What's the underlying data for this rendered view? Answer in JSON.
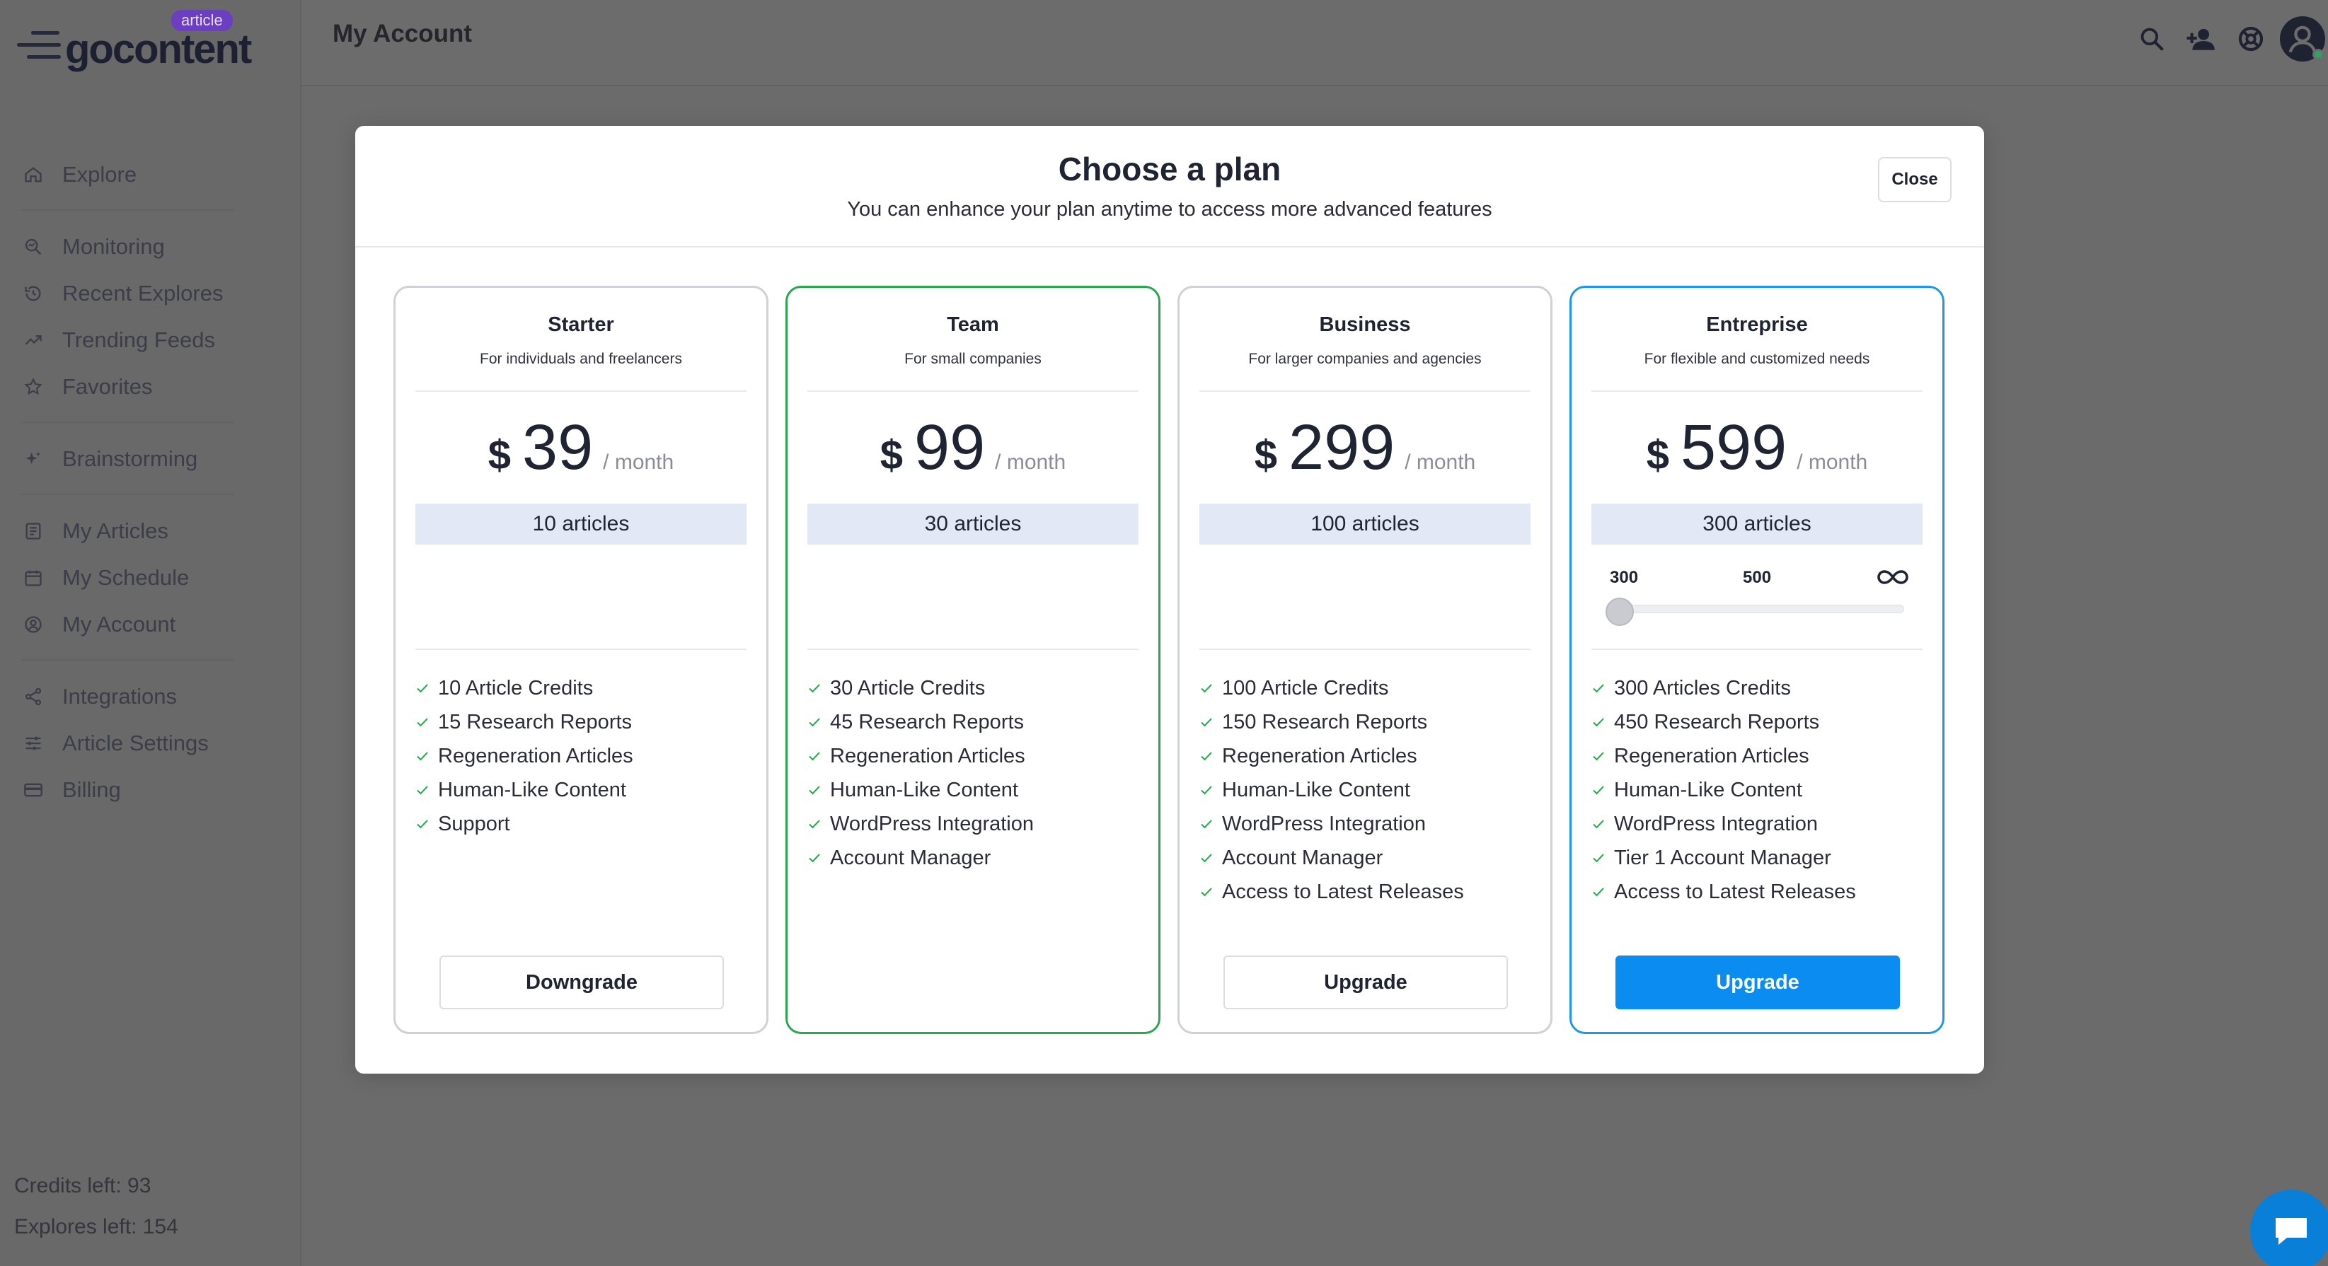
{
  "app": {
    "logo_text": "gocontent",
    "logo_badge": "article"
  },
  "header": {
    "page_title": "My Account",
    "icons": [
      "search-icon",
      "add-user-icon",
      "help-icon",
      "avatar"
    ]
  },
  "sidebar": {
    "groups": [
      [
        {
          "label": "Explore",
          "icon": "home-icon"
        }
      ],
      [
        {
          "label": "Monitoring",
          "icon": "monitoring-icon"
        },
        {
          "label": "Recent Explores",
          "icon": "history-icon"
        },
        {
          "label": "Trending Feeds",
          "icon": "trending-icon"
        },
        {
          "label": "Favorites",
          "icon": "star-icon"
        }
      ],
      [
        {
          "label": "Brainstorming",
          "icon": "sparkles-icon"
        }
      ],
      [
        {
          "label": "My Articles",
          "icon": "articles-icon"
        },
        {
          "label": "My Schedule",
          "icon": "calendar-icon"
        },
        {
          "label": "My Account",
          "icon": "account-icon"
        }
      ],
      [
        {
          "label": "Integrations",
          "icon": "share-icon"
        },
        {
          "label": "Article Settings",
          "icon": "sliders-icon"
        },
        {
          "label": "Billing",
          "icon": "card-icon"
        }
      ]
    ],
    "credits_left": "Credits left: 93",
    "explores_left": "Explores left: 154"
  },
  "modal": {
    "title": "Choose a plan",
    "subtitle": "You can enhance your plan anytime to access more advanced features",
    "close_label": "Close",
    "plans": [
      {
        "name": "Starter",
        "description": "For individuals and freelancers",
        "currency": "$",
        "price": "39",
        "period": "/ month",
        "articles": "10 articles",
        "features": [
          "10 Article Credits",
          "15 Research Reports",
          "Regeneration Articles",
          "Human-Like Content",
          "Support"
        ],
        "button_label": "Downgrade"
      },
      {
        "name": "Team",
        "description": "For small companies",
        "currency": "$",
        "price": "99",
        "period": "/ month",
        "articles": "30 articles",
        "features": [
          "30 Article Credits",
          "45 Research Reports",
          "Regeneration Articles",
          "Human-Like Content",
          "WordPress Integration",
          "Account Manager"
        ],
        "button_label": ""
      },
      {
        "name": "Business",
        "description": "For larger companies and agencies",
        "currency": "$",
        "price": "299",
        "period": "/ month",
        "articles": "100 articles",
        "features": [
          "100 Article Credits",
          "150 Research Reports",
          "Regeneration Articles",
          "Human-Like Content",
          "WordPress Integration",
          "Account Manager",
          "Access to Latest Releases"
        ],
        "button_label": "Upgrade"
      },
      {
        "name": "Entreprise",
        "description": "For flexible and customized needs",
        "currency": "$",
        "price": "599",
        "period": "/ month",
        "articles": "300 articles",
        "slider": {
          "labels": [
            "300",
            "500"
          ],
          "max_icon": "infinity-icon",
          "value_fraction": 0
        },
        "features": [
          "300 Articles Credits",
          "450 Research Reports",
          "Regeneration Articles",
          "Human-Like Content",
          "WordPress Integration",
          "Tier 1 Account Manager",
          "Access to Latest Releases"
        ],
        "button_label": "Upgrade"
      }
    ]
  },
  "colors": {
    "team_border": "#2aa74e",
    "enterprise_border": "#1e97e5",
    "primary_button": "#0a8cf0",
    "check": "#2aa74e"
  }
}
